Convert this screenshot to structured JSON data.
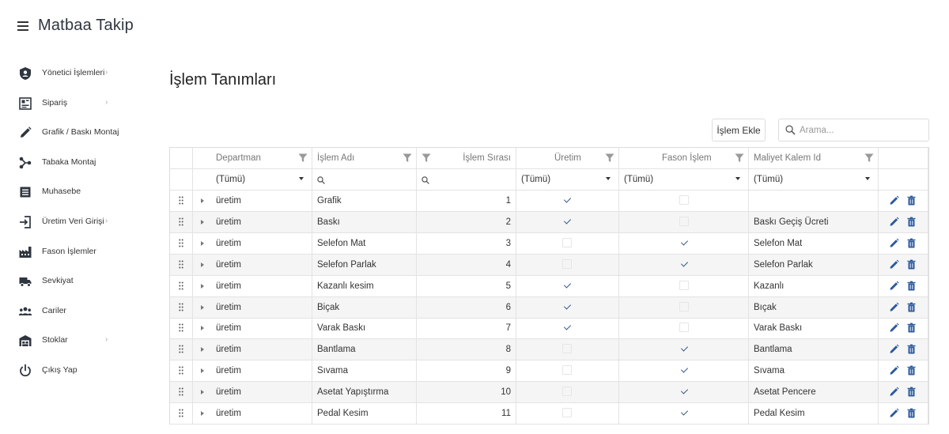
{
  "app": {
    "title": "Matbaa Takip"
  },
  "sidebar": {
    "items": [
      {
        "label": "Yönetici İşlemleri",
        "icon": "shield-user-icon",
        "has_submenu": true
      },
      {
        "label": "Sipariş",
        "icon": "order-grid-icon",
        "has_submenu": true
      },
      {
        "label": "Grafik / Baskı Montaj",
        "icon": "pencil-icon",
        "has_submenu": false
      },
      {
        "label": "Tabaka Montaj",
        "icon": "nodes-icon",
        "has_submenu": false
      },
      {
        "label": "Muhasebe",
        "icon": "ledger-icon",
        "has_submenu": false
      },
      {
        "label": "Üretim Veri Girişi",
        "icon": "login-arrow-icon",
        "has_submenu": true
      },
      {
        "label": "Fason İşlemler",
        "icon": "factory-icon",
        "has_submenu": false
      },
      {
        "label": "Sevkiyat",
        "icon": "truck-icon",
        "has_submenu": false
      },
      {
        "label": "Cariler",
        "icon": "people-icon",
        "has_submenu": false
      },
      {
        "label": "Stoklar",
        "icon": "warehouse-icon",
        "has_submenu": true
      },
      {
        "label": "Çıkış Yap",
        "icon": "power-icon",
        "has_submenu": false
      }
    ]
  },
  "main": {
    "title": "İşlem Tanımları",
    "add_button": "İşlem Ekle",
    "search_placeholder": "Arama..."
  },
  "grid": {
    "columns": {
      "departman": "Departman",
      "islem_adi": "İşlem Adı",
      "islem_sirasi": "İşlem Sırası",
      "uretim": "Üretim",
      "fason": "Fason İşlem",
      "maliyet": "Maliyet Kalem Id"
    },
    "filter_all": "(Tümü)",
    "rows": [
      {
        "departman": "üretim",
        "islem_adi": "Grafik",
        "sira": "1",
        "uretim": true,
        "fason": false,
        "maliyet": ""
      },
      {
        "departman": "üretim",
        "islem_adi": "Baskı",
        "sira": "2",
        "uretim": true,
        "fason": false,
        "maliyet": "Baskı Geçiş Ücreti"
      },
      {
        "departman": "üretim",
        "islem_adi": "Selefon Mat",
        "sira": "3",
        "uretim": false,
        "fason": true,
        "maliyet": "Selefon Mat"
      },
      {
        "departman": "üretim",
        "islem_adi": "Selefon Parlak",
        "sira": "4",
        "uretim": false,
        "fason": true,
        "maliyet": "Selefon Parlak"
      },
      {
        "departman": "üretim",
        "islem_adi": "Kazanlı kesim",
        "sira": "5",
        "uretim": true,
        "fason": false,
        "maliyet": "Kazanlı"
      },
      {
        "departman": "üretim",
        "islem_adi": "Biçak",
        "sira": "6",
        "uretim": true,
        "fason": false,
        "maliyet": "Bıçak"
      },
      {
        "departman": "üretim",
        "islem_adi": "Varak Baskı",
        "sira": "7",
        "uretim": true,
        "fason": false,
        "maliyet": "Varak Baskı"
      },
      {
        "departman": "üretim",
        "islem_adi": "Bantlama",
        "sira": "8",
        "uretim": false,
        "fason": true,
        "maliyet": "Bantlama"
      },
      {
        "departman": "üretim",
        "islem_adi": "Sıvama",
        "sira": "9",
        "uretim": false,
        "fason": true,
        "maliyet": "Sıvama"
      },
      {
        "departman": "üretim",
        "islem_adi": "Asetat Yapıştırma",
        "sira": "10",
        "uretim": false,
        "fason": true,
        "maliyet": "Asetat Pencere"
      },
      {
        "departman": "üretim",
        "islem_adi": "Pedal Kesim",
        "sira": "11",
        "uretim": false,
        "fason": true,
        "maliyet": "Pedal Kesim"
      }
    ]
  },
  "colors": {
    "accent": "#2c5a9e",
    "check": "#3a5a8c",
    "icon": "#2f3640"
  }
}
